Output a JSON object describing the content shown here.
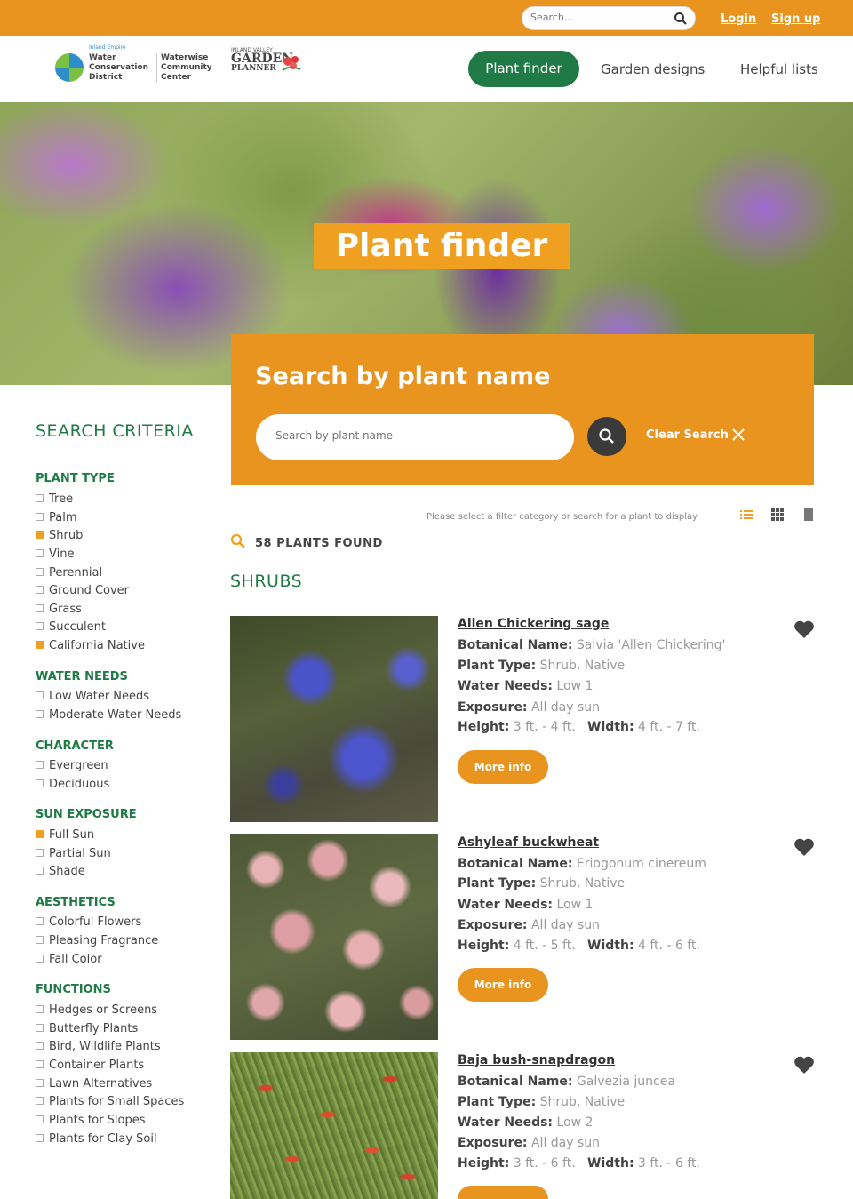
{
  "topbar": {
    "search_placeholder": "Search...",
    "login": "Login",
    "signup": "Sign up"
  },
  "header": {
    "logo1": {
      "small": "Inland Empire",
      "line1": "Water",
      "line2": "Conservation",
      "line3": "District",
      "line4": "Waterwise",
      "line5": "Community",
      "line6": "Center"
    },
    "logo2": {
      "small": "INLAND VALLEY",
      "line1": "GARDEN",
      "line2": "PLANNER"
    },
    "nav": [
      {
        "label": "Plant finder"
      },
      {
        "label": "Garden designs"
      },
      {
        "label": "Helpful lists"
      }
    ]
  },
  "hero": {
    "title": "Plant finder"
  },
  "search": {
    "title": "Search by plant name",
    "placeholder": "Search by plant name",
    "clear_label": "Clear Search"
  },
  "sidebar": {
    "title": "SEARCH CRITERIA",
    "sections": [
      {
        "title": "PLANT TYPE",
        "options": [
          {
            "label": "Tree",
            "checked": false
          },
          {
            "label": "Palm",
            "checked": false
          },
          {
            "label": "Shrub",
            "checked": true
          },
          {
            "label": "Vine",
            "checked": false
          },
          {
            "label": "Perennial",
            "checked": false
          },
          {
            "label": "Ground Cover",
            "checked": false
          },
          {
            "label": "Grass",
            "checked": false
          },
          {
            "label": "Succulent",
            "checked": false
          },
          {
            "label": "California Native",
            "checked": true
          }
        ]
      },
      {
        "title": "WATER NEEDS",
        "options": [
          {
            "label": "Low Water Needs",
            "checked": false
          },
          {
            "label": "Moderate Water Needs",
            "checked": false
          }
        ]
      },
      {
        "title": "CHARACTER",
        "options": [
          {
            "label": "Evergreen",
            "checked": false
          },
          {
            "label": "Deciduous",
            "checked": false
          }
        ]
      },
      {
        "title": "SUN EXPOSURE",
        "options": [
          {
            "label": "Full Sun",
            "checked": true
          },
          {
            "label": "Partial Sun",
            "checked": false
          },
          {
            "label": "Shade",
            "checked": false
          }
        ]
      },
      {
        "title": "AESTHETICS",
        "options": [
          {
            "label": "Colorful Flowers",
            "checked": false
          },
          {
            "label": "Pleasing Fragrance",
            "checked": false
          },
          {
            "label": "Fall Color",
            "checked": false
          }
        ]
      },
      {
        "title": "FUNCTIONS",
        "options": [
          {
            "label": "Hedges or Screens",
            "checked": false
          },
          {
            "label": "Butterfly Plants",
            "checked": false
          },
          {
            "label": "Bird, Wildlife Plants",
            "checked": false
          },
          {
            "label": "Container Plants",
            "checked": false
          },
          {
            "label": "Lawn Alternatives",
            "checked": false
          },
          {
            "label": "Plants for Small Spaces",
            "checked": false
          },
          {
            "label": "Plants for Slopes",
            "checked": false
          },
          {
            "label": "Plants for Clay Soil",
            "checked": false
          }
        ]
      }
    ]
  },
  "results": {
    "hint": "Please select a filter category or search for a plant to display",
    "found": "58 PLANTS FOUND",
    "category": "SHRUBS",
    "labels": {
      "botanical": "Botanical Name:",
      "type": "Plant Type:",
      "water": "Water Needs:",
      "exposure": "Exposure:",
      "height": "Height:",
      "width": "Width:",
      "more": "More info"
    },
    "plants": [
      {
        "name": "Allen Chickering sage",
        "botanical": "Salvia 'Allen Chickering'",
        "type": "Shrub, Native",
        "water": "Low 1",
        "exposure": "All day sun",
        "height": "3 ft. - 4 ft.",
        "width": "4 ft. - 7 ft."
      },
      {
        "name": "Ashyleaf buckwheat",
        "botanical": "Eriogonum cinereum",
        "type": "Shrub, Native",
        "water": "Low 1",
        "exposure": "All day sun",
        "height": "4 ft. - 5 ft.",
        "width": "4 ft. - 6 ft."
      },
      {
        "name": "Baja bush-snapdragon",
        "botanical": "Galvezia juncea",
        "type": "Shrub, Native",
        "water": "Low 2",
        "exposure": "All day sun",
        "height": "3 ft. - 6 ft.",
        "width": "3 ft. - 6 ft."
      }
    ]
  },
  "colors": {
    "accent_orange": "#e8941f",
    "brand_green": "#1f7a45",
    "dark_button": "#3a3a3a"
  }
}
